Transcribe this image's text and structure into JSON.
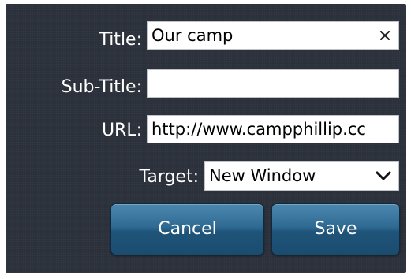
{
  "form": {
    "title_label": "Title:",
    "title_value": "Our camp",
    "subtitle_label": "Sub-Title:",
    "subtitle_value": "",
    "url_label": "URL:",
    "url_value": "http://www.campphillip.cc",
    "target_label": "Target:",
    "target_value": "New Window",
    "cancel_label": "Cancel",
    "save_label": "Save"
  },
  "icons": {
    "clear": "close-icon",
    "dropdown": "chevron-down-icon"
  },
  "colors": {
    "panel_background": "#2b303a",
    "button_blue": "#2f6a92",
    "label_text": "#ffffff"
  }
}
